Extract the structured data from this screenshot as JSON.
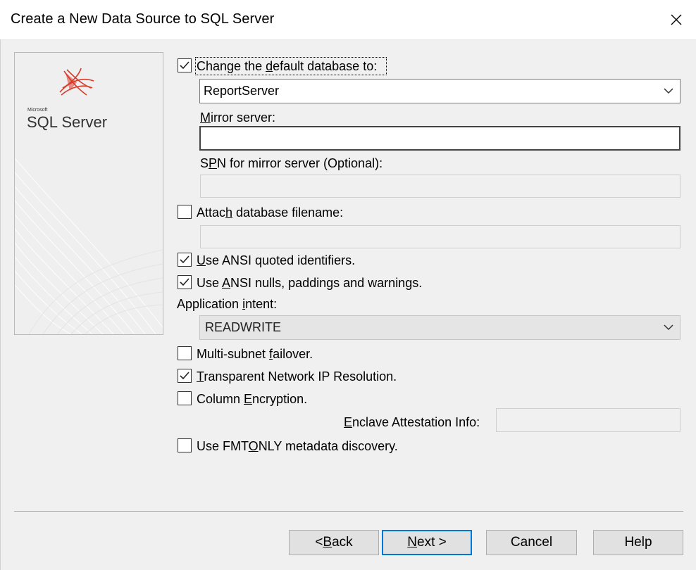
{
  "window": {
    "title": "Create a New Data Source to SQL Server"
  },
  "banner": {
    "brand_small": "Microsoft",
    "brand": "SQL Server"
  },
  "options": {
    "change_default_db": {
      "checked": true,
      "label_pre": "Change the ",
      "label_key": "d",
      "label_post": "efault database to:"
    },
    "default_db_value": "ReportServer",
    "mirror_server": {
      "label_key": "M",
      "label_post": "irror server:",
      "value": ""
    },
    "spn_mirror": {
      "label_pre": "S",
      "label_key": "P",
      "label_post": "N for mirror server (Optional):",
      "value": ""
    },
    "attach_db": {
      "checked": false,
      "label_pre": "Attac",
      "label_key": "h",
      "label_post": " database filename:",
      "value": ""
    },
    "ansi_quoted": {
      "checked": true,
      "label_key": "U",
      "label_post": "se ANSI quoted identifiers."
    },
    "ansi_nulls": {
      "checked": true,
      "label_pre": "Use ",
      "label_key": "A",
      "label_post": "NSI nulls, paddings and warnings."
    },
    "app_intent": {
      "label_pre": "Application ",
      "label_key": "i",
      "label_post": "ntent:",
      "value": "READWRITE"
    },
    "multi_subnet": {
      "checked": false,
      "label_pre": "Multi-subnet ",
      "label_key": "f",
      "label_post": "ailover."
    },
    "tnir": {
      "checked": true,
      "label_key": "T",
      "label_post": "ransparent Network IP Resolution."
    },
    "column_encryption": {
      "checked": false,
      "label_pre": "Column ",
      "label_key": "E",
      "label_post": "ncryption."
    },
    "enclave": {
      "label_key": "E",
      "label_post": "nclave Attestation Info:",
      "value": ""
    },
    "fmtonly": {
      "checked": false,
      "label_pre": "Use FMT",
      "label_key": "O",
      "label_post": "NLY metadata discovery."
    }
  },
  "buttons": {
    "back": {
      "pre": "< ",
      "key": "B",
      "post": "ack"
    },
    "next": {
      "key": "N",
      "post": "ext >"
    },
    "cancel": "Cancel",
    "help": "Help"
  },
  "colors": {
    "accent": "#0078d7",
    "logo_red": "#d83b2a"
  }
}
